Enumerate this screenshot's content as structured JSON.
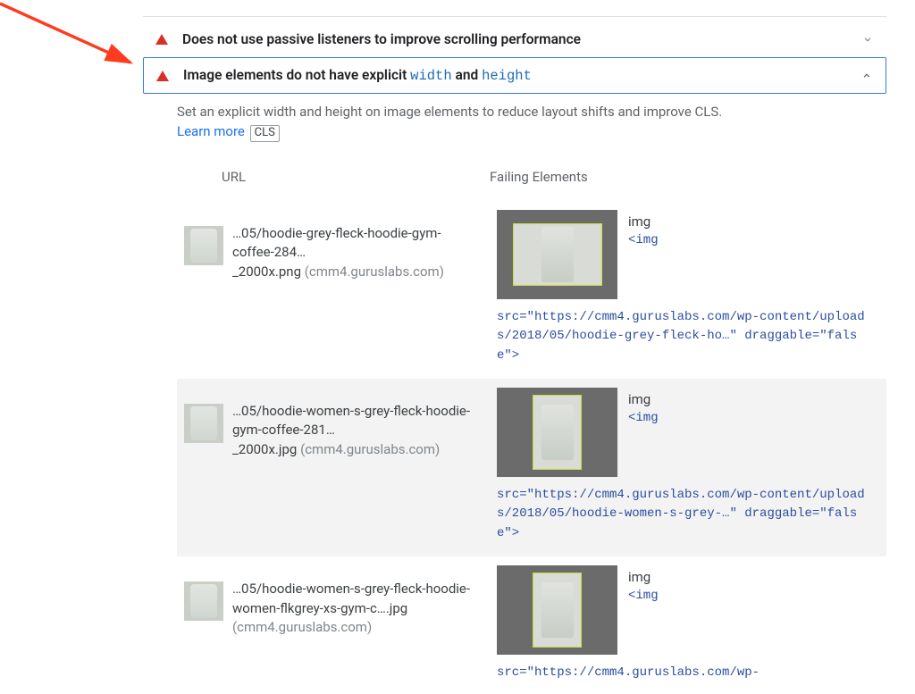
{
  "audits": {
    "passive": {
      "title_plain": "Does not use passive listeners to improve scrolling performance"
    },
    "imgsize": {
      "title_prefix": "Image elements do not have explicit ",
      "kw1": "width",
      "mid": " and ",
      "kw2": "height",
      "description": "Set an explicit width and height on image elements to reduce layout shifts and improve CLS.",
      "learn_more": "Learn more",
      "chip": "CLS"
    }
  },
  "table": {
    "headers": {
      "url": "URL",
      "failing": "Failing Elements"
    },
    "rows": [
      {
        "url_line1": "…05/hoodie-grey-fleck-hoodie-gym-coffee-284…",
        "url_line2": "_2000x.png",
        "domain": "(cmm4.guruslabs.com)",
        "img_label": "img",
        "tag_open": "<img",
        "src_text": "src=\"https://cmm4.guruslabs.com/wp-content/uploads/2018/05/hoodie-grey-fleck-ho…\" draggable=\"false\">"
      },
      {
        "url_line1": "…05/hoodie-women-s-grey-fleck-hoodie-gym-coffee-281…",
        "url_line2": "_2000x.jpg",
        "domain": "(cmm4.guruslabs.com)",
        "img_label": "img",
        "tag_open": "<img",
        "src_text": "src=\"https://cmm4.guruslabs.com/wp-content/uploads/2018/05/hoodie-women-s-grey-…\" draggable=\"false\">"
      },
      {
        "url_line1": "…05/hoodie-women-s-grey-fleck-hoodie-women-flkgrey-xs-gym-c….jpg",
        "url_line2": "",
        "domain": "(cmm4.guruslabs.com)",
        "img_label": "img",
        "tag_open": "<img",
        "src_text": "src=\"https://cmm4.guruslabs.com/wp-"
      }
    ]
  }
}
